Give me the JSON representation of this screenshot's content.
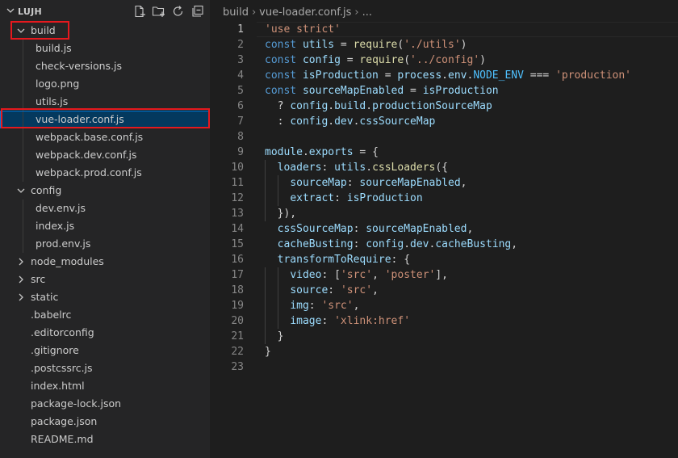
{
  "explorer": {
    "root_label": "LUJH"
  },
  "tree": [
    {
      "label": "build",
      "depth": 1,
      "folder": true,
      "open": true
    },
    {
      "label": "build.js",
      "depth": 2
    },
    {
      "label": "check-versions.js",
      "depth": 2
    },
    {
      "label": "logo.png",
      "depth": 2
    },
    {
      "label": "utils.js",
      "depth": 2
    },
    {
      "label": "vue-loader.conf.js",
      "depth": 2,
      "selected": true
    },
    {
      "label": "webpack.base.conf.js",
      "depth": 2
    },
    {
      "label": "webpack.dev.conf.js",
      "depth": 2
    },
    {
      "label": "webpack.prod.conf.js",
      "depth": 2
    },
    {
      "label": "config",
      "depth": 1,
      "folder": true,
      "open": true
    },
    {
      "label": "dev.env.js",
      "depth": 2
    },
    {
      "label": "index.js",
      "depth": 2
    },
    {
      "label": "prod.env.js",
      "depth": 2
    },
    {
      "label": "node_modules",
      "depth": 1,
      "folder": true,
      "open": false
    },
    {
      "label": "src",
      "depth": 1,
      "folder": true,
      "open": false
    },
    {
      "label": "static",
      "depth": 1,
      "folder": true,
      "open": false
    },
    {
      "label": ".babelrc",
      "depth": 1
    },
    {
      "label": ".editorconfig",
      "depth": 1
    },
    {
      "label": ".gitignore",
      "depth": 1
    },
    {
      "label": ".postcssrc.js",
      "depth": 1
    },
    {
      "label": "index.html",
      "depth": 1
    },
    {
      "label": "package-lock.json",
      "depth": 1
    },
    {
      "label": "package.json",
      "depth": 1
    },
    {
      "label": "README.md",
      "depth": 1
    }
  ],
  "breadcrumb": {
    "folder": "build",
    "file": "vue-loader.conf.js",
    "more": "..."
  },
  "editor": {
    "current_line": 1,
    "lines": [
      [
        [
          "s",
          "'use strict'"
        ]
      ],
      [
        [
          "k",
          "const "
        ],
        [
          "v",
          "utils"
        ],
        [
          "p",
          " = "
        ],
        [
          "f",
          "require"
        ],
        [
          "p",
          "("
        ],
        [
          "s",
          "'./utils'"
        ],
        [
          "p",
          ")"
        ]
      ],
      [
        [
          "k",
          "const "
        ],
        [
          "v",
          "config"
        ],
        [
          "p",
          " = "
        ],
        [
          "f",
          "require"
        ],
        [
          "p",
          "("
        ],
        [
          "s",
          "'../config'"
        ],
        [
          "p",
          ")"
        ]
      ],
      [
        [
          "k",
          "const "
        ],
        [
          "v",
          "isProduction"
        ],
        [
          "p",
          " = "
        ],
        [
          "v",
          "process"
        ],
        [
          "p",
          "."
        ],
        [
          "v",
          "env"
        ],
        [
          "p",
          "."
        ],
        [
          "c",
          "NODE_ENV"
        ],
        [
          "p",
          " === "
        ],
        [
          "s",
          "'production'"
        ]
      ],
      [
        [
          "k",
          "const "
        ],
        [
          "v",
          "sourceMapEnabled"
        ],
        [
          "p",
          " = "
        ],
        [
          "v",
          "isProduction"
        ]
      ],
      [
        [
          "p",
          "  ? "
        ],
        [
          "v",
          "config"
        ],
        [
          "p",
          "."
        ],
        [
          "v",
          "build"
        ],
        [
          "p",
          "."
        ],
        [
          "v",
          "productionSourceMap"
        ]
      ],
      [
        [
          "p",
          "  : "
        ],
        [
          "v",
          "config"
        ],
        [
          "p",
          "."
        ],
        [
          "v",
          "dev"
        ],
        [
          "p",
          "."
        ],
        [
          "v",
          "cssSourceMap"
        ]
      ],
      [],
      [
        [
          "v",
          "module"
        ],
        [
          "p",
          "."
        ],
        [
          "v",
          "exports"
        ],
        [
          "p",
          " = {"
        ]
      ],
      [
        [
          "p",
          "  "
        ],
        [
          "v",
          "loaders"
        ],
        [
          "p",
          ": "
        ],
        [
          "v",
          "utils"
        ],
        [
          "p",
          "."
        ],
        [
          "f",
          "cssLoaders"
        ],
        [
          "p",
          "({"
        ]
      ],
      [
        [
          "p",
          "    "
        ],
        [
          "v",
          "sourceMap"
        ],
        [
          "p",
          ": "
        ],
        [
          "v",
          "sourceMapEnabled"
        ],
        [
          "p",
          ","
        ]
      ],
      [
        [
          "p",
          "    "
        ],
        [
          "v",
          "extract"
        ],
        [
          "p",
          ": "
        ],
        [
          "v",
          "isProduction"
        ]
      ],
      [
        [
          "p",
          "  }),"
        ]
      ],
      [
        [
          "p",
          "  "
        ],
        [
          "v",
          "cssSourceMap"
        ],
        [
          "p",
          ": "
        ],
        [
          "v",
          "sourceMapEnabled"
        ],
        [
          "p",
          ","
        ]
      ],
      [
        [
          "p",
          "  "
        ],
        [
          "v",
          "cacheBusting"
        ],
        [
          "p",
          ": "
        ],
        [
          "v",
          "config"
        ],
        [
          "p",
          "."
        ],
        [
          "v",
          "dev"
        ],
        [
          "p",
          "."
        ],
        [
          "v",
          "cacheBusting"
        ],
        [
          "p",
          ","
        ]
      ],
      [
        [
          "p",
          "  "
        ],
        [
          "v",
          "transformToRequire"
        ],
        [
          "p",
          ": {"
        ]
      ],
      [
        [
          "p",
          "    "
        ],
        [
          "v",
          "video"
        ],
        [
          "p",
          ": ["
        ],
        [
          "s",
          "'src'"
        ],
        [
          "p",
          ", "
        ],
        [
          "s",
          "'poster'"
        ],
        [
          "p",
          "],"
        ]
      ],
      [
        [
          "p",
          "    "
        ],
        [
          "v",
          "source"
        ],
        [
          "p",
          ": "
        ],
        [
          "s",
          "'src'"
        ],
        [
          "p",
          ","
        ]
      ],
      [
        [
          "p",
          "    "
        ],
        [
          "v",
          "img"
        ],
        [
          "p",
          ": "
        ],
        [
          "s",
          "'src'"
        ],
        [
          "p",
          ","
        ]
      ],
      [
        [
          "p",
          "    "
        ],
        [
          "v",
          "image"
        ],
        [
          "p",
          ": "
        ],
        [
          "s",
          "'xlink:href'"
        ]
      ],
      [
        [
          "p",
          "  }"
        ]
      ],
      [
        [
          "p",
          "}"
        ]
      ],
      []
    ]
  },
  "icons": {
    "header": [
      "new-file-icon",
      "new-folder-icon",
      "refresh-icon",
      "collapse-all-icon"
    ]
  }
}
